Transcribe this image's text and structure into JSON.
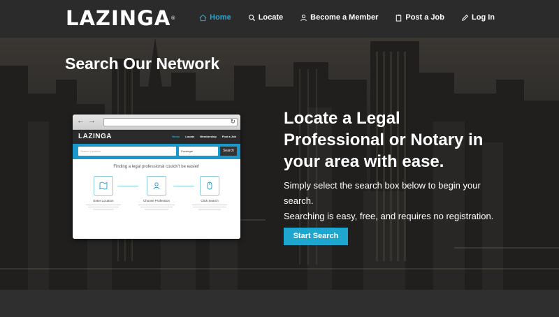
{
  "header": {
    "logo": "LAZINGA",
    "logo_mark": "®",
    "nav": [
      {
        "label": "Home",
        "icon": "home-icon",
        "active": true
      },
      {
        "label": "Locate",
        "icon": "search-icon",
        "active": false
      },
      {
        "label": "Become a Member",
        "icon": "user-icon",
        "active": false
      },
      {
        "label": "Post a Job",
        "icon": "clipboard-icon",
        "active": false
      },
      {
        "label": "Log In",
        "icon": "pencil-icon",
        "active": false
      }
    ]
  },
  "hero": {
    "section_title": "Search Our Network",
    "heading_line1": "Locate a Legal",
    "heading_line2": "Professional or Notary in",
    "heading_line3": "your area with ease.",
    "text_line1": "Simply select the search box below to begin your",
    "text_line2": "search.",
    "text_line3": "Searching is easy, free, and requires no registration.",
    "cta_label": "Start Search"
  },
  "mockup": {
    "logo": "LAZINGA",
    "links": [
      "Home",
      "Locate",
      "Membership",
      "Post a Job"
    ],
    "search_placeholder": "Search Location",
    "select_value": "Paralegal",
    "search_button": "Search",
    "tagline": "Finding a legal professional couldn't be easier!",
    "steps": [
      {
        "label": "Enter Location"
      },
      {
        "label": "Choose Profession"
      },
      {
        "label": "Click Search"
      }
    ]
  },
  "colors": {
    "accent": "#1fa6cf",
    "header_bg": "#2b2b2b",
    "active_nav": "#2aa5d0"
  }
}
